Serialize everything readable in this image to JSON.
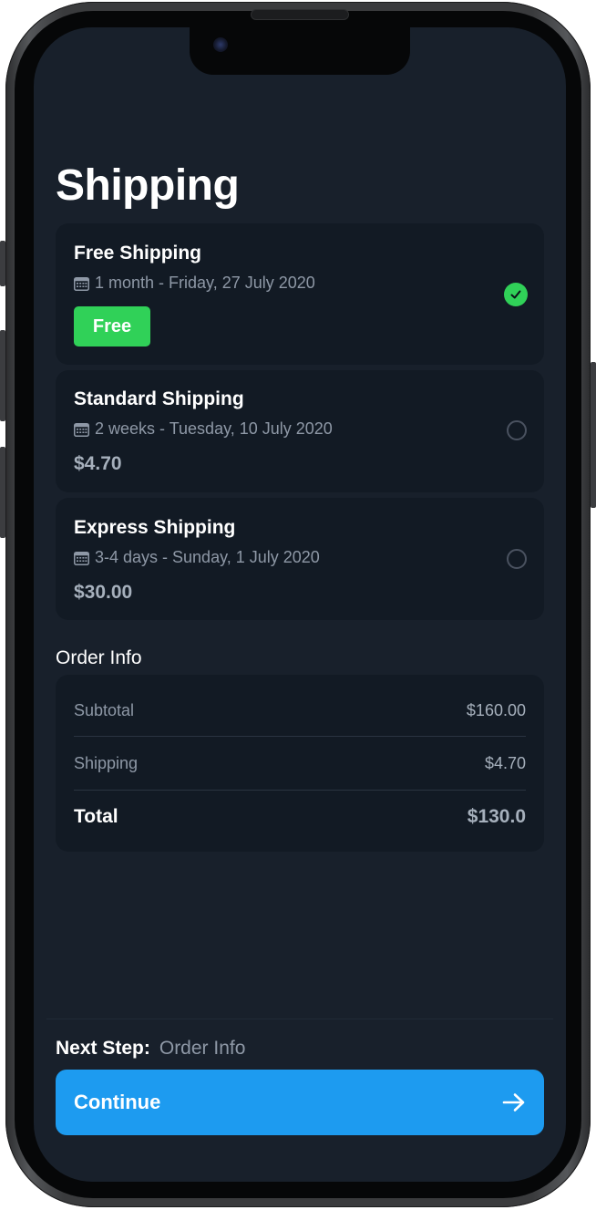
{
  "page": {
    "title": "Shipping"
  },
  "shipping_options": [
    {
      "title": "Free Shipping",
      "date": "1 month - Friday, 27 July 2020",
      "price": "Free",
      "selected": true
    },
    {
      "title": "Standard Shipping",
      "date": "2 weeks - Tuesday, 10 July 2020",
      "price": "$4.70",
      "selected": false
    },
    {
      "title": "Express Shipping",
      "date": "3-4 days - Sunday, 1 July 2020",
      "price": "$30.00",
      "selected": false
    }
  ],
  "order_info": {
    "title": "Order Info",
    "subtotal_label": "Subtotal",
    "subtotal_value": "$160.00",
    "shipping_label": "Shipping",
    "shipping_value": "$4.70",
    "total_label": "Total",
    "total_value": "$130.0"
  },
  "footer": {
    "next_step_label": "Next Step:",
    "next_step_value": "Order Info",
    "continue_label": "Continue"
  },
  "icons": {
    "calendar": "calendar-icon",
    "check": "check-icon",
    "arrow": "arrow-right-icon"
  },
  "colors": {
    "background": "#18202b",
    "card": "#121a24",
    "accent": "#1d9bf0",
    "success": "#30d158"
  }
}
